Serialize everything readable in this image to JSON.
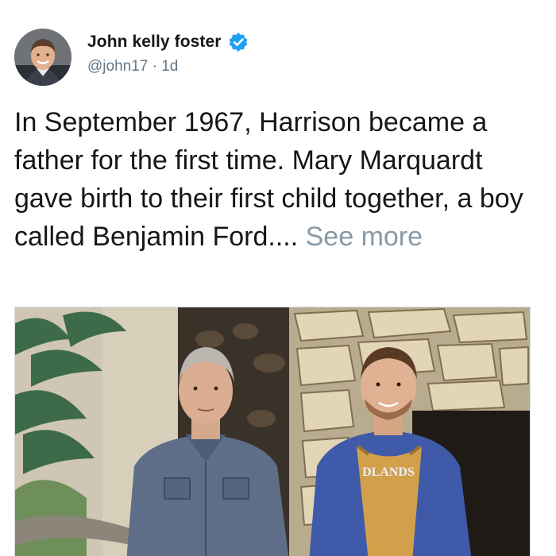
{
  "author": {
    "display_name": "John kelly foster",
    "handle": "@john17",
    "separator": "·",
    "age": "1d",
    "verified": true,
    "avatar_icon": "profile-photo"
  },
  "tweet": {
    "text": "In September 1967, Harrison became a father for the first time. Mary Marquardt gave birth to their first child together, a boy called Benjamin Ford....",
    "see_more": "See more"
  },
  "media": {
    "type": "photo",
    "apron_text": "DLANDS"
  },
  "colors": {
    "text": "#14171a",
    "secondary": "#657786",
    "link_muted": "#8899a6",
    "verified": "#1da1f2"
  }
}
